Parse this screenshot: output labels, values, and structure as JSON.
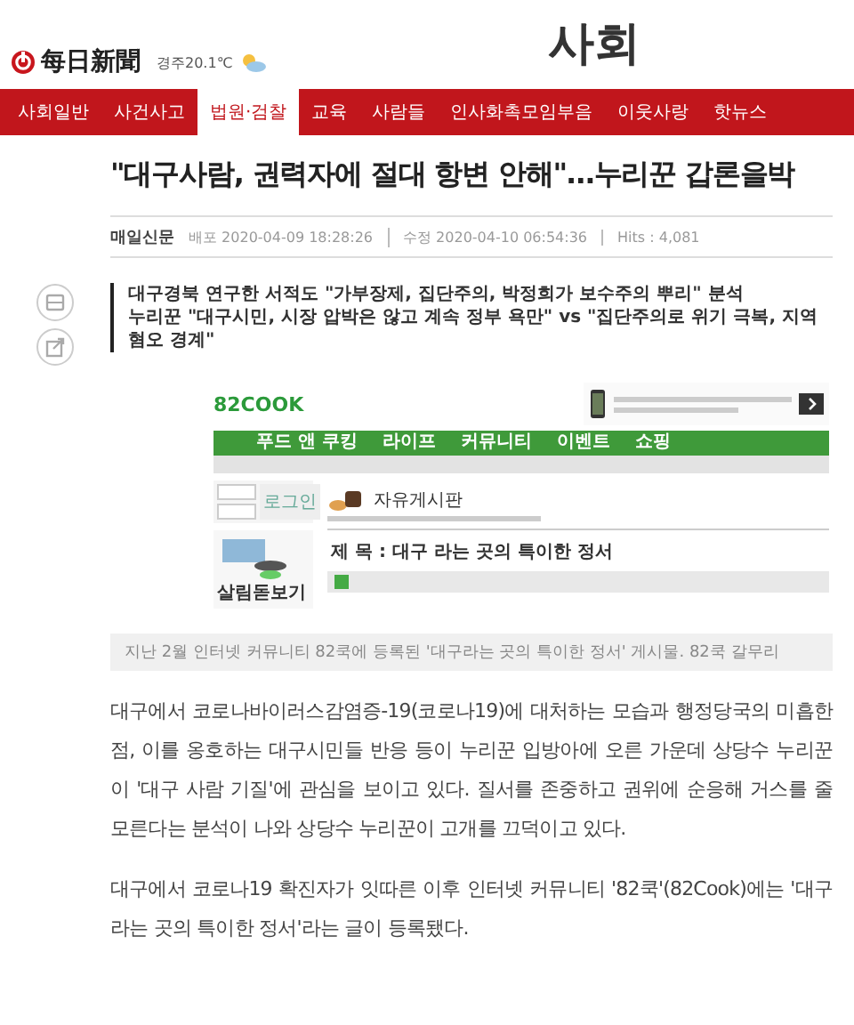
{
  "header": {
    "logo": "每日新聞",
    "weather": "경주20.1℃",
    "section_title": "사회"
  },
  "nav_tabs": [
    {
      "label": "사회일반",
      "selected": false
    },
    {
      "label": "사건사고",
      "selected": false
    },
    {
      "label": "법원·검찰",
      "selected": true
    },
    {
      "label": "교육",
      "selected": false
    },
    {
      "label": "사람들",
      "selected": false
    },
    {
      "label": "인사화촉모임부음",
      "selected": false
    },
    {
      "label": "이웃사랑",
      "selected": false
    },
    {
      "label": "핫뉴스",
      "selected": false
    }
  ],
  "article": {
    "title": "\"대구사람, 권력자에 절대 항변 안해\"…누리꾼 갑론을박",
    "meta": {
      "source": "매일신문",
      "published_label": "배포",
      "published": "2020-04-09 18:28:26",
      "modified_label": "수정",
      "modified": "2020-04-10 06:54:36",
      "hits": "Hits : 4,081"
    },
    "summary": [
      "대구경북 연구한 서적도 \"가부장제, 집단주의, 박정희가 보수주의 뿌리\" 분석",
      "누리꾼 \"대구시민, 시장 압박은 않고 계속 정부 욕만\" vs \"집단주의로 위기 극복, 지역혐오 경계\""
    ],
    "figure": {
      "site_logo": "82COOK",
      "menu": [
        "푸드 앤 쿠킹",
        "라이프",
        "커뮤니티",
        "이벤트",
        "쇼핑"
      ],
      "login_button": "로그인",
      "side_banner": "살림돋보기",
      "board_title": "자유게시판",
      "post_title": "제 목 : 대구 라는 곳의 특이한 정서",
      "caption": "지난 2월 인터넷 커뮤니티 82쿡에 등록된 '대구라는 곳의 특이한 정서' 게시물. 82쿡 갈무리"
    },
    "paragraphs": [
      "대구에서 코로나바이러스감염증-19(코로나19)에 대처하는 모습과 행정당국의 미흡한 점, 이를 옹호하는 대구시민들 반응 등이 누리꾼 입방아에 오른 가운데 상당수 누리꾼이 '대구 사람 기질'에 관심을 보이고 있다. 질서를 존중하고 권위에 순응해 거스를 줄 모른다는 분석이 나와 상당수 누리꾼이 고개를 끄덕이고 있다.",
      "대구에서 코로나19 확진자가 잇따른 이후 인터넷 커뮤니티 '82쿡'(82Cook)에는 '대구라는 곳의 특이한 정서'라는 글이 등록됐다."
    ]
  }
}
